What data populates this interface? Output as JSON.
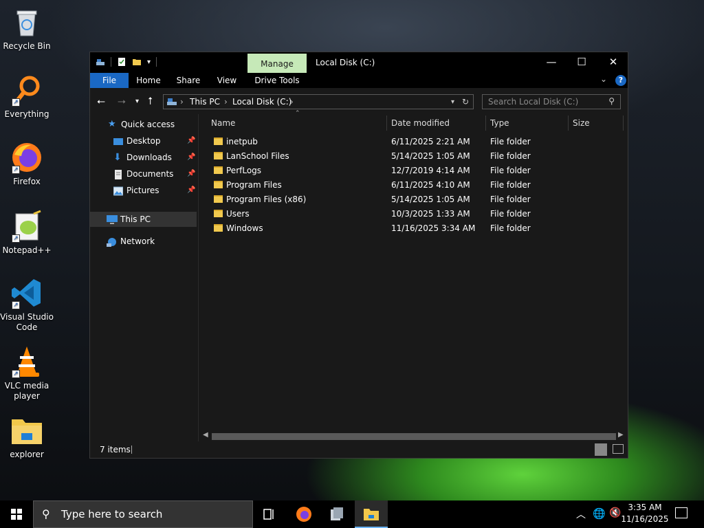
{
  "desktop": {
    "icons": [
      {
        "label": "Recycle Bin",
        "icon": "recycle-bin-icon"
      },
      {
        "label": "Everything",
        "icon": "everything-search-icon"
      },
      {
        "label": "Firefox",
        "icon": "firefox-icon"
      },
      {
        "label": "Notepad++",
        "icon": "notepad-plus-plus-icon"
      },
      {
        "label": "Visual Studio Code",
        "icon": "vscode-icon"
      },
      {
        "label": "VLC media player",
        "icon": "vlc-icon"
      },
      {
        "label": "explorer",
        "icon": "explorer-icon"
      }
    ]
  },
  "window": {
    "title": "Local Disk (C:)",
    "context_tab": "Manage",
    "ribbon_tabs": [
      "File",
      "Home",
      "Share",
      "View",
      "Drive Tools"
    ],
    "controls": {
      "minimize": "—",
      "maximize": "☐",
      "close": "✕"
    },
    "help": "?",
    "address": {
      "crumbs": [
        "This PC",
        "Local Disk (C:)"
      ],
      "separator": "›"
    },
    "search_placeholder": "Search Local Disk (C:)",
    "nav": {
      "quick_access": "Quick access",
      "items": [
        {
          "label": "Desktop",
          "pinned": true
        },
        {
          "label": "Downloads",
          "pinned": true
        },
        {
          "label": "Documents",
          "pinned": true
        },
        {
          "label": "Pictures",
          "pinned": true
        }
      ],
      "this_pc": "This PC",
      "network": "Network"
    },
    "columns": {
      "name": "Name",
      "date": "Date modified",
      "type": "Type",
      "size": "Size"
    },
    "files": [
      {
        "name": "inetpub",
        "date": "6/11/2025 2:21 AM",
        "type": "File folder"
      },
      {
        "name": "LanSchool Files",
        "date": "5/14/2025 1:05 AM",
        "type": "File folder"
      },
      {
        "name": "PerfLogs",
        "date": "12/7/2019 4:14 AM",
        "type": "File folder"
      },
      {
        "name": "Program Files",
        "date": "6/11/2025 4:10 AM",
        "type": "File folder"
      },
      {
        "name": "Program Files (x86)",
        "date": "5/14/2025 1:05 AM",
        "type": "File folder"
      },
      {
        "name": "Users",
        "date": "10/3/2025 1:33 AM",
        "type": "File folder"
      },
      {
        "name": "Windows",
        "date": "11/16/2025 3:34 AM",
        "type": "File folder"
      }
    ],
    "status": "7 items"
  },
  "taskbar": {
    "search_placeholder": "Type here to search",
    "time": "3:35 AM",
    "date": "11/16/2025"
  },
  "colors": {
    "accent": "#1a68c4",
    "manage_tab": "#c6e9b8",
    "folder": "#f1c94e"
  }
}
